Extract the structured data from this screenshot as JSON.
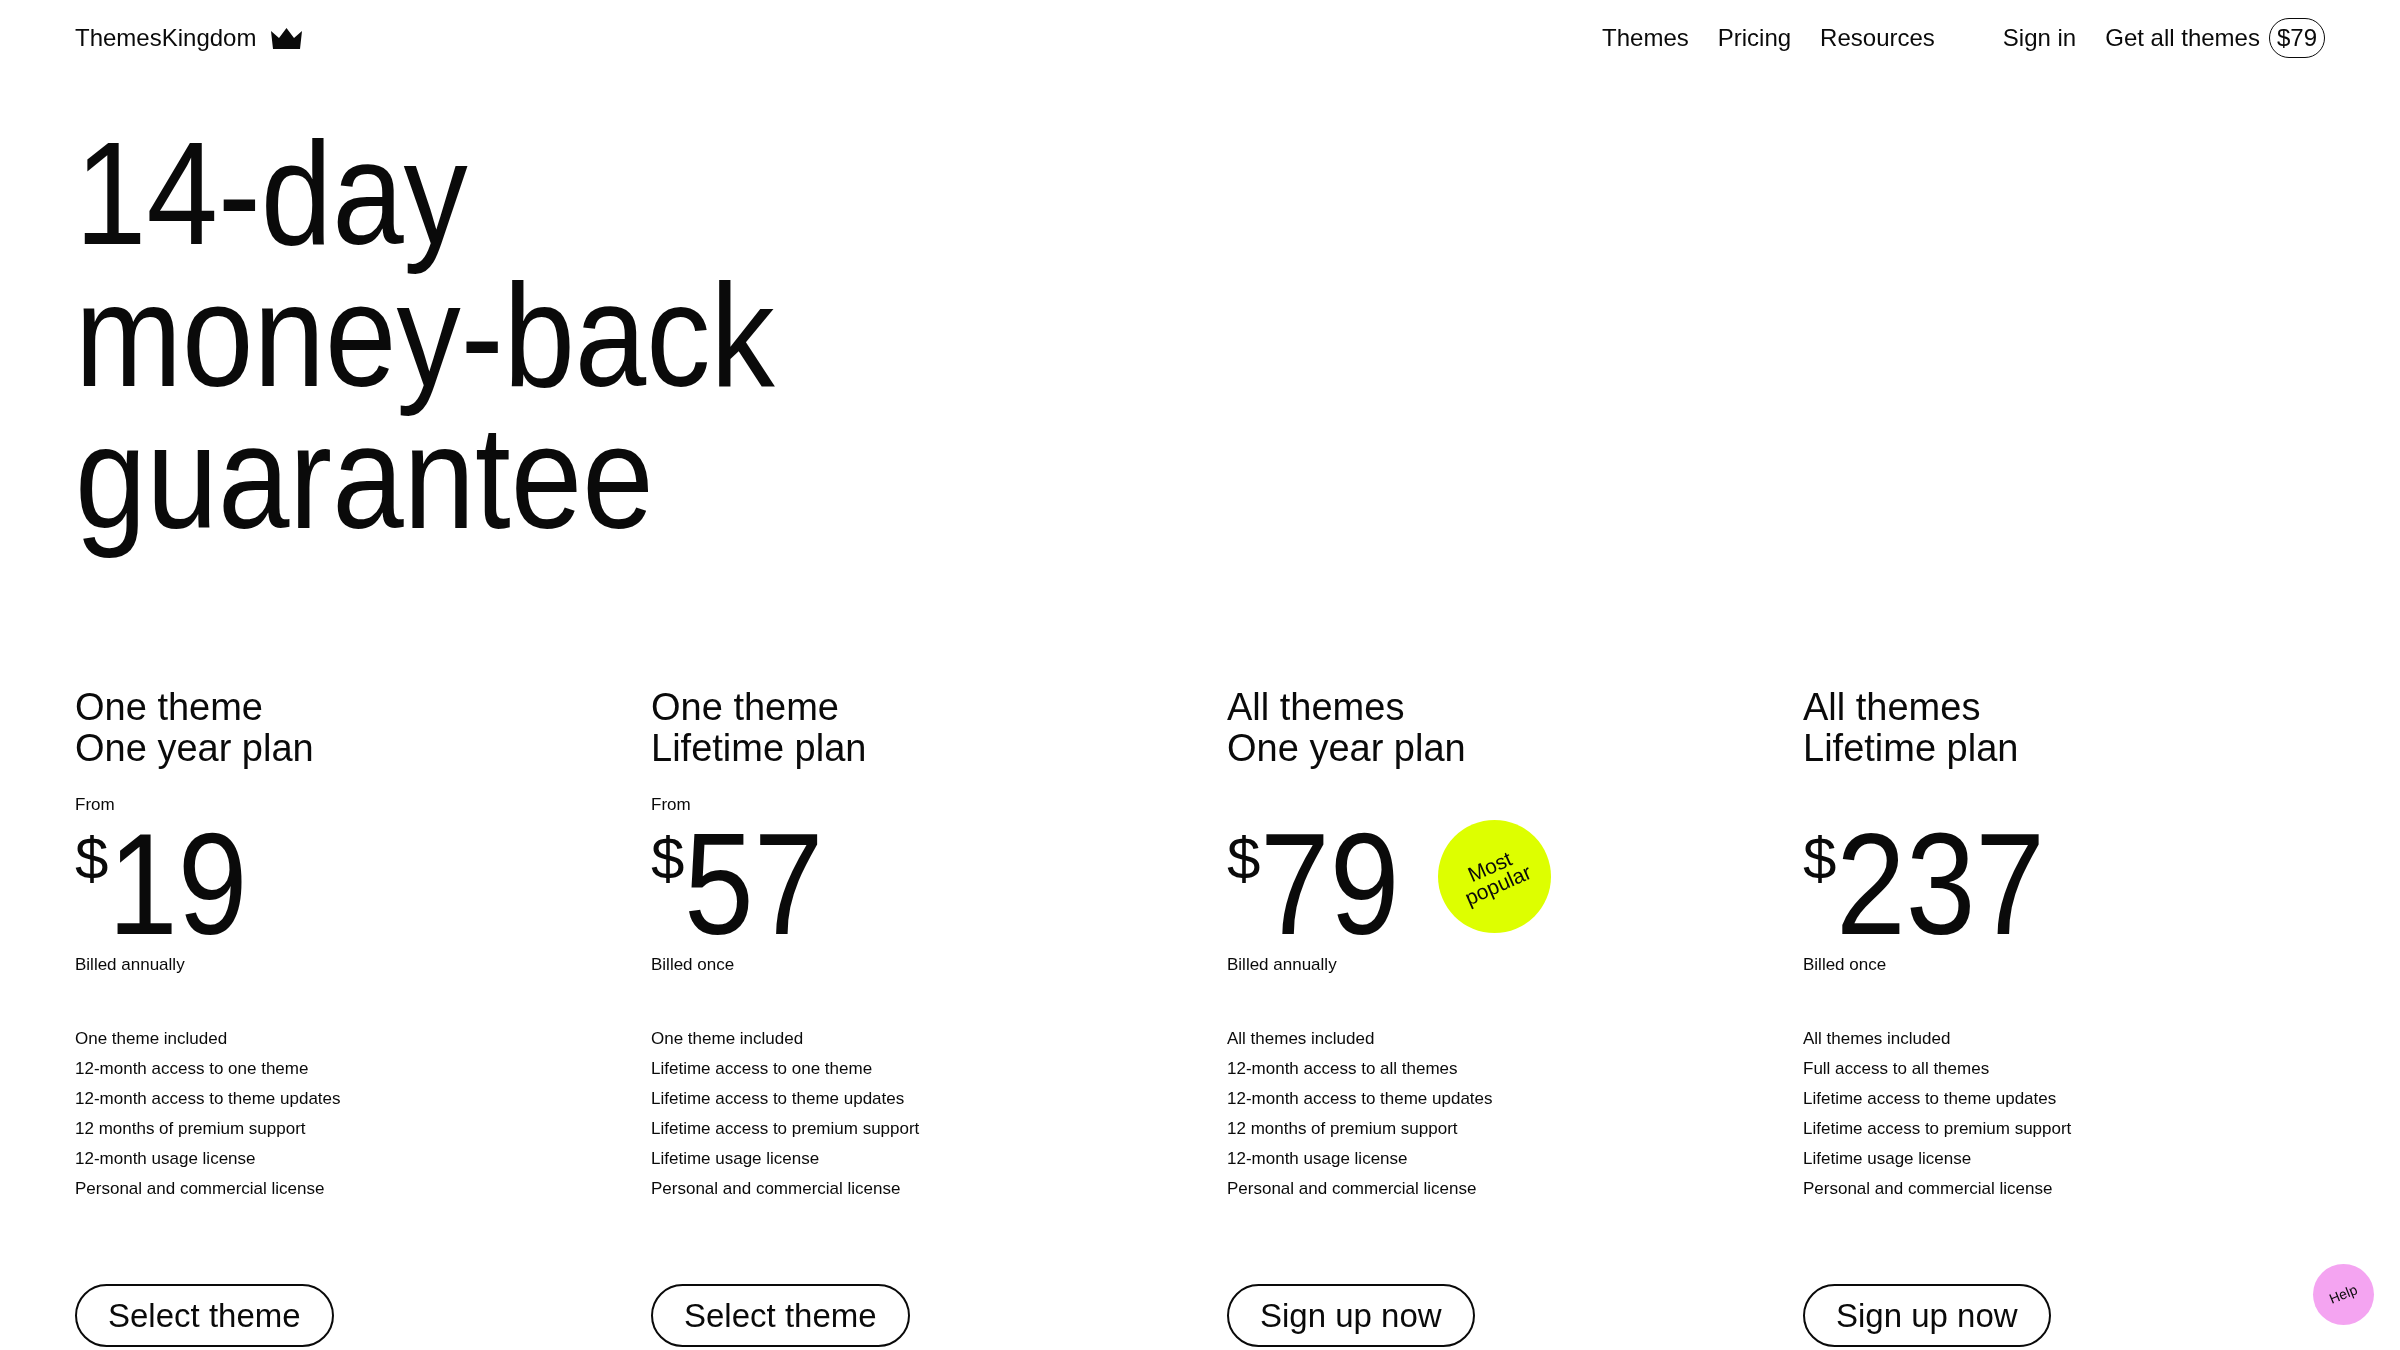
{
  "header": {
    "logo": "ThemesKingdom",
    "nav": [
      "Themes",
      "Pricing",
      "Resources"
    ],
    "sign_in": "Sign in",
    "cta": {
      "label": "Get all themes",
      "price": "$79"
    }
  },
  "hero": {
    "title_lines": [
      "14-day",
      "money-back",
      "guarantee"
    ]
  },
  "plans": [
    {
      "title_lines": [
        "One theme",
        "One year plan"
      ],
      "from": "From",
      "currency": "$",
      "amount": "19",
      "billing": "Billed annually",
      "features": [
        "One theme included",
        "12-month access to one theme",
        "12-month access to theme updates",
        "12 months of premium support",
        "12-month usage license",
        "Personal and commercial license"
      ],
      "button": "Select theme"
    },
    {
      "title_lines": [
        "One theme",
        "Lifetime plan"
      ],
      "from": "From",
      "currency": "$",
      "amount": "57",
      "billing": "Billed once",
      "features": [
        "One theme included",
        "Lifetime access to one theme",
        "Lifetime access to theme updates",
        "Lifetime access to premium support",
        "Lifetime usage license",
        "Personal and commercial license"
      ],
      "button": "Select theme"
    },
    {
      "title_lines": [
        "All themes",
        "One year plan"
      ],
      "currency": "$",
      "amount": "79",
      "badge": "Most popular",
      "billing": "Billed annually",
      "features": [
        "All themes included",
        "12-month access to all themes",
        "12-month access to theme updates",
        "12 months of premium support",
        "12-month usage license",
        "Personal and commercial license"
      ],
      "button": "Sign up now"
    },
    {
      "title_lines": [
        "All themes",
        "Lifetime plan"
      ],
      "currency": "$",
      "amount": "237",
      "billing": "Billed once",
      "features": [
        "All themes included",
        "Full access to all themes",
        "Lifetime access to theme updates",
        "Lifetime access to premium support",
        "Lifetime usage license",
        "Personal and commercial license"
      ],
      "button": "Sign up now"
    }
  ],
  "help_button": "Help"
}
